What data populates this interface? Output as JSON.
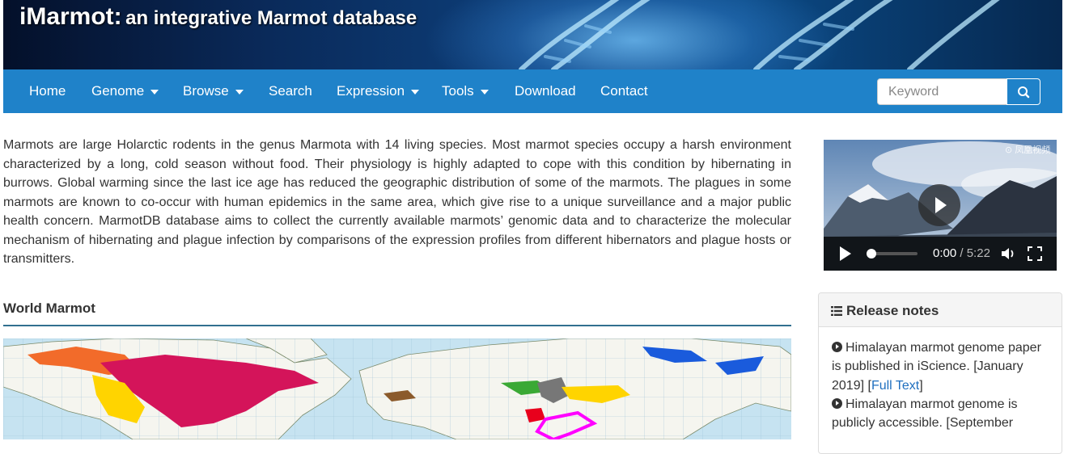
{
  "header": {
    "brand": "iMarmot:",
    "tagline": "an integrative Marmot database"
  },
  "nav": {
    "items": [
      {
        "label": "Home",
        "dropdown": false
      },
      {
        "label": "Genome",
        "dropdown": true
      },
      {
        "label": "Browse",
        "dropdown": true
      },
      {
        "label": "Search",
        "dropdown": false
      },
      {
        "label": "Expression",
        "dropdown": true
      },
      {
        "label": "Tools",
        "dropdown": true
      },
      {
        "label": "Download",
        "dropdown": false
      },
      {
        "label": "Contact",
        "dropdown": false
      }
    ],
    "search": {
      "placeholder": "Keyword",
      "icon": "search-icon"
    }
  },
  "intro": {
    "text": "Marmots are large Holarctic rodents in the genus Marmota with 14 living species. Most marmot species occupy a harsh environment characterized by a long, cold season without food. Their physiology is highly adapted to cope with this condition by hibernating in burrows. Global warming since the last ice age has reduced the geographic distribution of some of the marmots. The plagues in some marmots are known to co-occur with human epidemics in the same area, which give rise to a unique surveillance and a major public health concern. MarmotDB database aims to collect the currently available marmots’ genomic data and to characterize the molecular mechanism of hibernating and plague infection by comparisons of the expression profiles from different hibernators and plague hosts or transmitters."
  },
  "world_map": {
    "title": "World Marmot",
    "region_colors": [
      "#f26b2a",
      "#d4145a",
      "#ffd400",
      "#8b5a2b",
      "#3aa935",
      "#777777",
      "#e8001c",
      "#ff00ff",
      "#1a5bdc"
    ]
  },
  "video": {
    "current_time": "0:00",
    "separator": " / ",
    "duration": "5:22",
    "progress": 0,
    "watermark": "⊙ 凤凰视频"
  },
  "release_notes": {
    "title": "Release notes",
    "items": [
      {
        "text": "Himalayan marmot genome paper is published in iScience. [January 2019] [",
        "link": "Full Text",
        "after": "]"
      },
      {
        "text": "Himalayan marmot genome is publicly accessible. [September",
        "link": "",
        "after": ""
      }
    ]
  },
  "colors": {
    "navbar": "#1f82c9",
    "section_rule": "#31708f",
    "link": "#1f6fbf"
  }
}
